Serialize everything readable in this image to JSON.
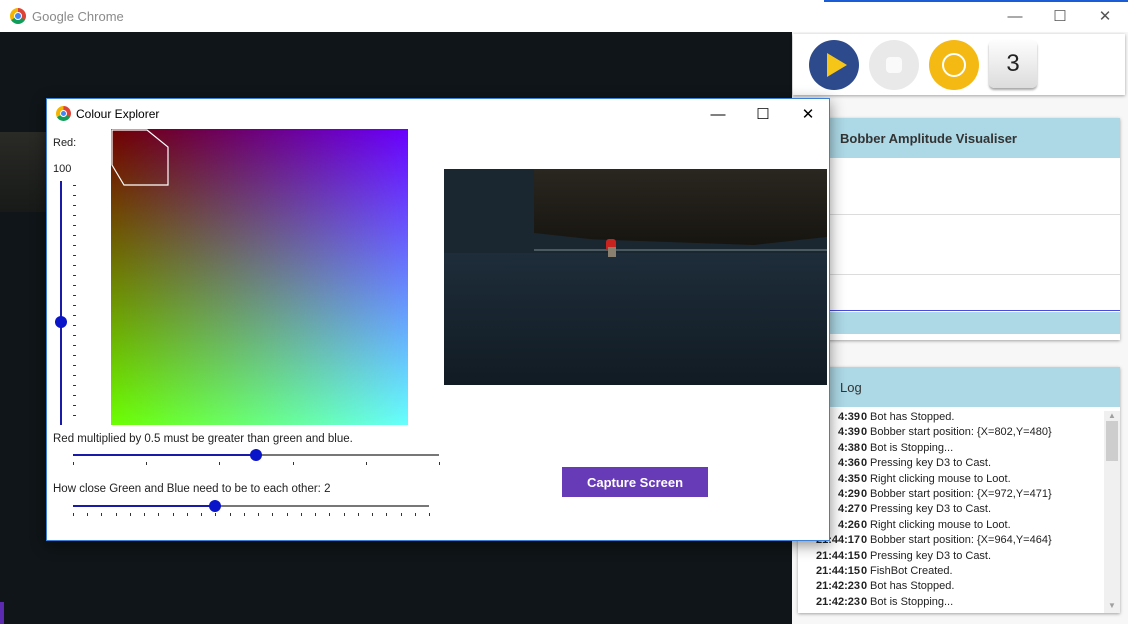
{
  "chrome": {
    "title": "Google Chrome",
    "controls": {
      "minimize": "—",
      "maximize": "☐",
      "close": "✕"
    }
  },
  "toolbar": {
    "key_label": "3"
  },
  "visualiser": {
    "title": "Bobber Amplitude Visualiser"
  },
  "log": {
    "title": "Log",
    "entries": [
      {
        "time": "4:39",
        "level": "0",
        "message": "Bot has Stopped."
      },
      {
        "time": "4:39",
        "level": "0",
        "message": "Bobber start position: {X=802,Y=480}"
      },
      {
        "time": "4:38",
        "level": "0",
        "message": "Bot is Stopping..."
      },
      {
        "time": "4:36",
        "level": "0",
        "message": "Pressing key D3 to Cast."
      },
      {
        "time": "4:35",
        "level": "0",
        "message": "Right clicking mouse to Loot."
      },
      {
        "time": "4:29",
        "level": "0",
        "message": "Bobber start position: {X=972,Y=471}"
      },
      {
        "time": "4:27",
        "level": "0",
        "message": "Pressing key D3 to Cast."
      },
      {
        "time": "4:26",
        "level": "0",
        "message": "Right clicking mouse to Loot."
      },
      {
        "time": "21:44:17",
        "level": "0",
        "message": "Bobber start position: {X=964,Y=464}"
      },
      {
        "time": "21:44:15",
        "level": "0",
        "message": "Pressing key D3 to Cast."
      },
      {
        "time": "21:44:15",
        "level": "0",
        "message": "FishBot Created."
      },
      {
        "time": "21:42:23",
        "level": "0",
        "message": "Bot has Stopped."
      },
      {
        "time": "21:42:23",
        "level": "0",
        "message": "Bot is Stopping..."
      }
    ]
  },
  "colour_explorer": {
    "title": "Colour Explorer",
    "red_label": "Red:",
    "red_value": "100",
    "rule_text": "Red multiplied by 0.5 must be greater than green and blue.",
    "closeness_text": "How close Green and Blue need to be to each other: 2",
    "capture_button": "Capture Screen",
    "red_slider_level": 0.42,
    "multiplier_slider_level": 0.5,
    "closeness_slider_level": 0.4
  }
}
